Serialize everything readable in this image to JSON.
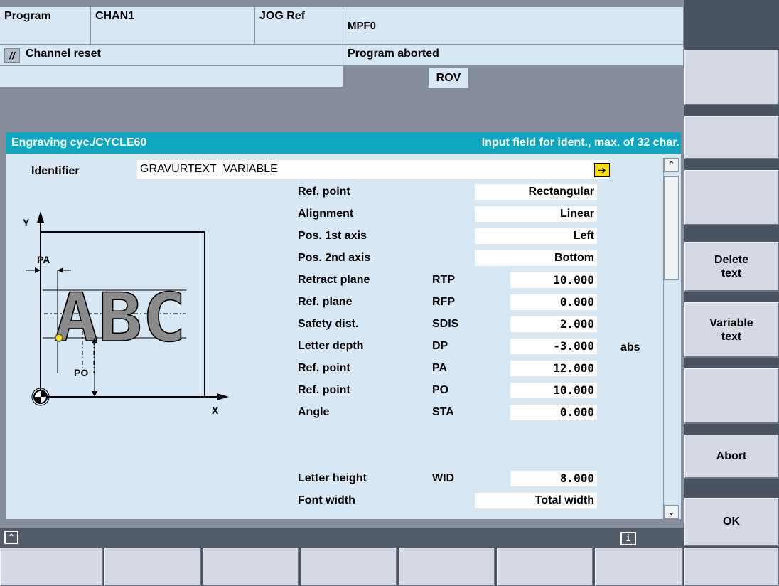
{
  "header": {
    "program_label": "Program",
    "channel": "CHAN1",
    "mode": "JOG Ref",
    "program_name": "MPF0",
    "channel_status": "Channel reset",
    "program_status": "Program aborted",
    "rov": "ROV"
  },
  "dialog": {
    "title": "Engraving cyc./CYCLE60",
    "hint": "Input field for ident., max. of 32 char.",
    "identifier_label": "Identifier",
    "identifier_value": "GRAVURTEXT_VARIABLE"
  },
  "params": [
    {
      "label": "Ref. point",
      "code": "",
      "value": "Rectangular",
      "unit": ""
    },
    {
      "label": "Alignment",
      "code": "",
      "value": "Linear",
      "unit": ""
    },
    {
      "label": "Pos. 1st axis",
      "code": "",
      "value": "Left",
      "unit": ""
    },
    {
      "label": "Pos. 2nd axis",
      "code": "",
      "value": "Bottom",
      "unit": ""
    },
    {
      "label": "Retract plane",
      "code": "RTP",
      "value": "10.000",
      "unit": ""
    },
    {
      "label": "Ref. plane",
      "code": "RFP",
      "value": "0.000",
      "unit": ""
    },
    {
      "label": "Safety dist.",
      "code": "SDIS",
      "value": "2.000",
      "unit": ""
    },
    {
      "label": "Letter depth",
      "code": "DP",
      "value": "-3.000",
      "unit": "abs"
    },
    {
      "label": "Ref. point",
      "code": "PA",
      "value": "12.000",
      "unit": ""
    },
    {
      "label": "Ref. point",
      "code": "PO",
      "value": "10.000",
      "unit": ""
    },
    {
      "label": "Angle",
      "code": "STA",
      "value": "0.000",
      "unit": ""
    },
    {
      "label": "Letter height",
      "code": "WID",
      "value": "8.000",
      "unit": ""
    },
    {
      "label": "Font width",
      "code": "",
      "value": "Total width",
      "unit": ""
    }
  ],
  "diagram": {
    "y_axis": "Y",
    "x_axis": "X",
    "pa": "PA",
    "po": "PO",
    "letters": "ABC"
  },
  "softkeys": {
    "delete_text": [
      "Delete",
      "text"
    ],
    "variable_text": [
      "Variable",
      "text"
    ],
    "abort": "Abort",
    "ok": "OK"
  },
  "footer": {
    "info": "i"
  }
}
